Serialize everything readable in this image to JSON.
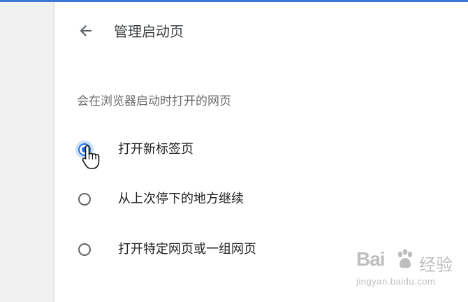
{
  "header": {
    "title": "管理启动页",
    "back_icon": "arrow-left-icon"
  },
  "section": {
    "description": "会在浏览器启动时打开的网页"
  },
  "options": [
    {
      "label": "打开新标签页",
      "selected": true
    },
    {
      "label": "从上次停下的地方继续",
      "selected": false
    },
    {
      "label": "打开特定网页或一组网页",
      "selected": false
    }
  ],
  "colors": {
    "accent": "#1a73e8",
    "topbar": "#3c78d8",
    "sidebar_bg": "#f1f1f1"
  },
  "watermark": {
    "brand": "Bai",
    "brand_suffix": "经验",
    "domain": "jingyan.baidu.com"
  }
}
